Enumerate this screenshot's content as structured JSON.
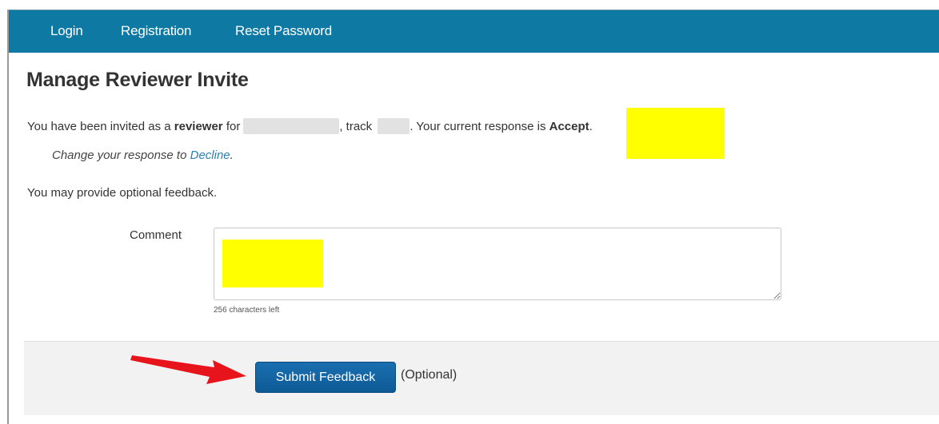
{
  "nav": {
    "login": "Login",
    "registration": "Registration",
    "reset_password": "Reset Password"
  },
  "page": {
    "title": "Manage Reviewer Invite"
  },
  "invite": {
    "part1": "You have been invited as a ",
    "role": "reviewer",
    "part2": " for",
    "part3": ", track ",
    "part4": ". Your current response is ",
    "response": "Accept",
    "part5": "."
  },
  "change": {
    "prefix": "Change your response to ",
    "link": "Decline",
    "suffix": "."
  },
  "feedback_prompt": "You may provide optional feedback.",
  "comment": {
    "label": "Comment",
    "value": "",
    "chars_left": "256 characters left"
  },
  "actions": {
    "submit_label": "Submit Feedback",
    "optional_note": "(Optional)"
  },
  "colors": {
    "navbar": "#0e7aa3",
    "highlight": "#ffff00",
    "submit_button": "#0d5a95",
    "annotation_arrow": "#e8141b"
  }
}
